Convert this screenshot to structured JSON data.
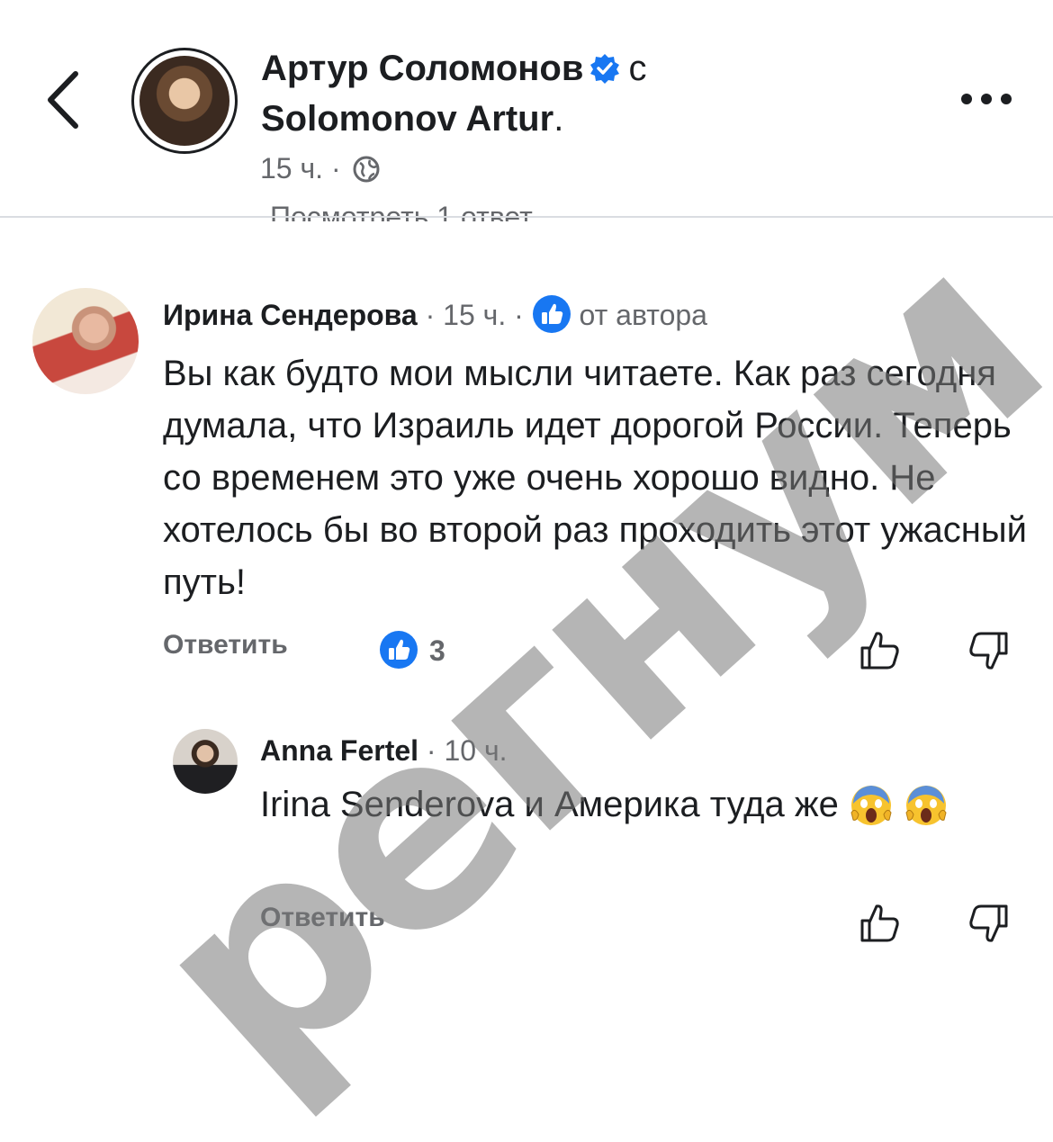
{
  "header": {
    "author_name": "Артур Соломонов",
    "connector": "с",
    "coauthor_name": "Solomonov Artur",
    "period": ".",
    "time": "15 ч.",
    "separator": "·",
    "back_icon": "chevron-left-icon",
    "more_icon": "more-horizontal-icon",
    "privacy_icon": "globe-icon",
    "verified_color": "#1877f2",
    "hidden_text": "Посмотреть 1 ответ"
  },
  "comment1": {
    "author": "Ирина Сендерова",
    "dot1": "·",
    "time": "15 ч.",
    "dot2": "·",
    "badge_text": "от автора",
    "text": "Вы как будто мои мысли читаете. Как раз сегодня думала, что Израиль идет дорогой России. Теперь со временем это уже очень хорошо видно. Не хотелось бы во второй раз проходить этот ужасный путь!",
    "reply_label": "Ответить",
    "reactions_count": "3",
    "reaction_icon": "like-icon"
  },
  "comment2": {
    "author": "Anna Fertel",
    "dot": "·",
    "time": "10 ч.",
    "mention": "Irina  Senderova",
    "text": " и Америка туда же",
    "emoji": "scream-emoji",
    "reply_label": "Ответить"
  },
  "watermark": {
    "text": "регнум"
  },
  "colors": {
    "accent": "#1877f2",
    "muted": "#65676b",
    "text": "#1c1e21"
  }
}
